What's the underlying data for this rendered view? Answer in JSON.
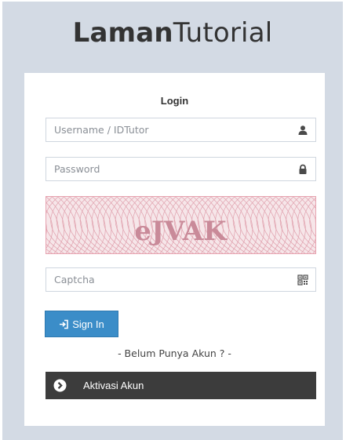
{
  "brand": {
    "bold": "Laman",
    "light": "Tutorial"
  },
  "login": {
    "title": "Login",
    "username_placeholder": "Username / IDTutor",
    "password_placeholder": "Password",
    "captcha_text": "eJVAK",
    "captcha_placeholder": "Captcha",
    "sign_in_label": "Sign In",
    "no_account_text": "- Belum Punya Akun ? -",
    "activate_label": "Aktivasi Akun"
  },
  "icons": {
    "username": "user-icon",
    "password": "lock-icon",
    "captcha": "qrcode-icon",
    "sign_in": "sign-in-icon",
    "activate": "chevron-right-circle-icon"
  },
  "colors": {
    "page_background": "#d3dae4",
    "primary_button": "#3b8dc8",
    "activate_bar": "#3c3c3c",
    "captcha_text": "#c98a99"
  }
}
